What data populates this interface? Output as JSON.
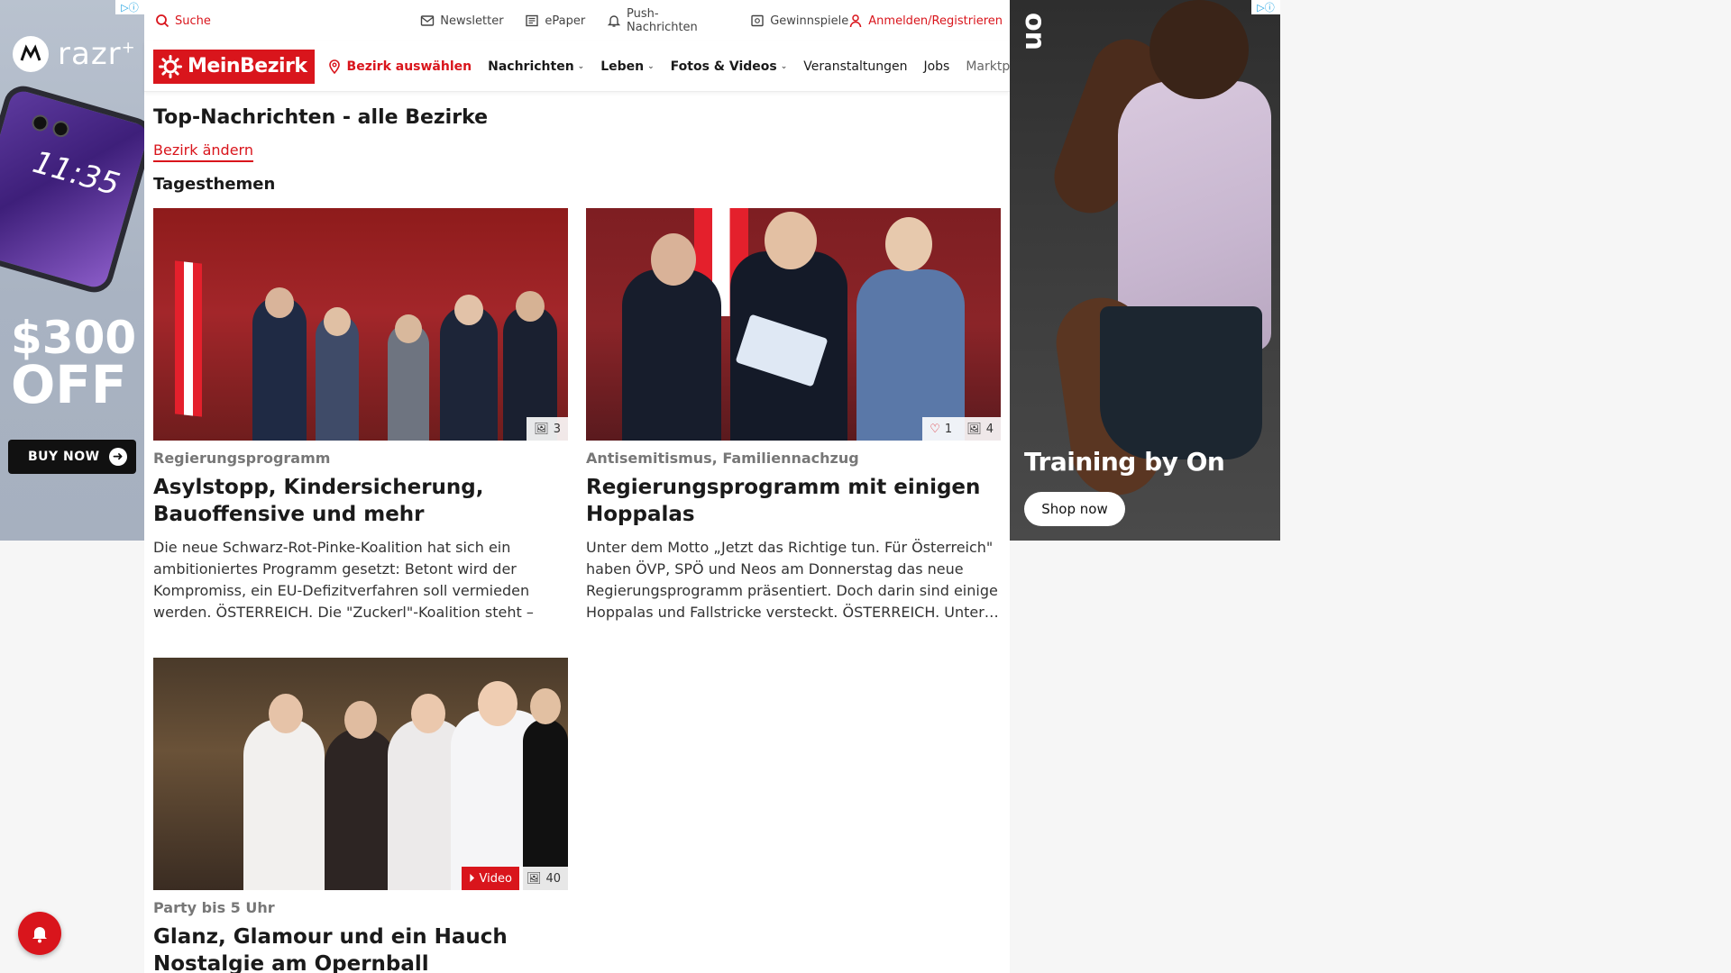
{
  "ads": {
    "left": {
      "brand": "razr",
      "brand_sup": "+",
      "phone_time": "11:35",
      "amount": "$300",
      "off": "OFF",
      "cta": "BUY NOW"
    },
    "right": {
      "logo": "on",
      "tagline": "Training by On",
      "cta": "Shop now"
    }
  },
  "topbar": {
    "search": "Suche",
    "newsletter": "Newsletter",
    "epaper": "ePaper",
    "push": "Push-Nachrichten",
    "gewinnspiele": "Gewinnspiele",
    "login": "Anmelden/Registrieren"
  },
  "navbar": {
    "logo": "MeinBezirk",
    "bezirk": "Bezirk auswählen",
    "items": [
      {
        "label": "Nachrichten",
        "dropdown": true
      },
      {
        "label": "Leben",
        "dropdown": true
      },
      {
        "label": "Fotos & Videos",
        "dropdown": true
      },
      {
        "label": "Veranstaltungen",
        "dropdown": false
      },
      {
        "label": "Jobs",
        "dropdown": false
      },
      {
        "label": "Marktplatz",
        "dropdown": false
      }
    ]
  },
  "page": {
    "title": "Top-Nachrichten - alle Bezirke",
    "change_link": "Bezirk ändern",
    "section": "Tagesthemen"
  },
  "articles": [
    {
      "kicker": "Regierungsprogramm",
      "headline": "Asylstopp, Kindersicherung, Bauoffensive und mehr",
      "teaser": "Die neue Schwarz-Rot-Pinke-Koalition hat sich ein ambitioniertes Programm gesetzt: Betont wird der Kompromiss, ein EU-Defizitverfahren soll vermieden werden.  ÖSTERREICH. Die \"Zuckerl\"-Koalition steht – unte…",
      "photos": "3"
    },
    {
      "kicker": "Antisemitismus, Familiennachzug",
      "headline": "Regierungsprogramm mit einigen Hoppalas",
      "teaser": "Unter dem Motto „Jetzt das Richtige tun. Für Österreich\" haben ÖVP, SPÖ und Neos am Donnerstag das neue Regierungsprogramm präsentiert. Doch darin sind einige Hoppalas und Fallstricke versteckt. ÖSTERREICH. Unter…",
      "likes": "1",
      "photos": "4"
    },
    {
      "kicker": "Party bis 5 Uhr",
      "headline": "Glanz, Glamour und ein Hauch Nostalgie am Opernball",
      "video": "Video",
      "photos": "40"
    }
  ]
}
